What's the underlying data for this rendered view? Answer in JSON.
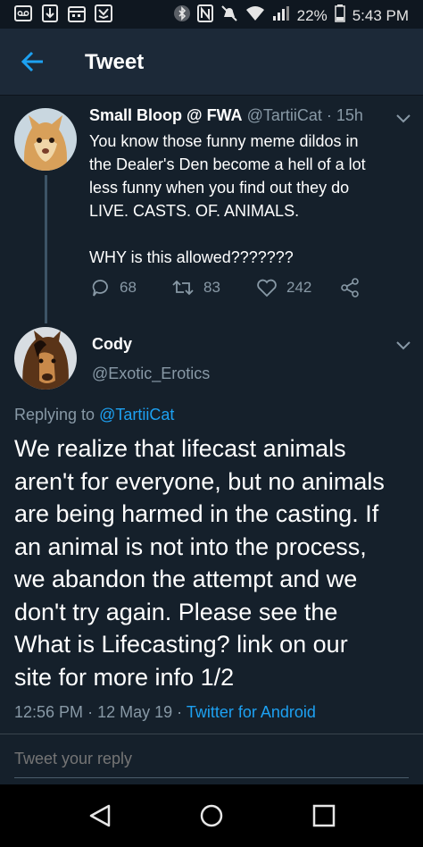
{
  "status_bar": {
    "battery_percent": "22%",
    "time": "5:43 PM"
  },
  "app_bar": {
    "title": "Tweet"
  },
  "parent_tweet": {
    "display_name": "Small Bloop @ FWA",
    "handle": "@TartiiCat",
    "age": "· 15h",
    "text_lines": [
      "You know those funny meme dildos in",
      "the Dealer's Den become a hell of a lot",
      "less funny when you find out they do",
      "LIVE. CASTS. OF. ANIMALS.",
      "",
      "WHY is this allowed???????"
    ],
    "replies": "68",
    "retweets": "83",
    "likes": "242"
  },
  "main_tweet": {
    "display_name": "Cody",
    "handle": "@Exotic_Erotics",
    "replying_prefix": "Replying to",
    "replying_to": "@TartiiCat",
    "text_lines": [
      "We realize that lifecast animals",
      "aren't for everyone, but no animals",
      "are being harmed in the casting. If",
      "an animal is not into the process,",
      "we abandon the attempt and we",
      "don't try again. Please see the",
      "What is Lifecasting? link on our",
      "site for more info 1/2"
    ],
    "time": "12:56 PM",
    "date": "12 May 19",
    "source": "Twitter for Android"
  },
  "reply_box": {
    "placeholder": "Tweet your reply"
  },
  "colors": {
    "background": "#15202b",
    "accent": "#1da1f2",
    "muted": "#8899a6"
  }
}
